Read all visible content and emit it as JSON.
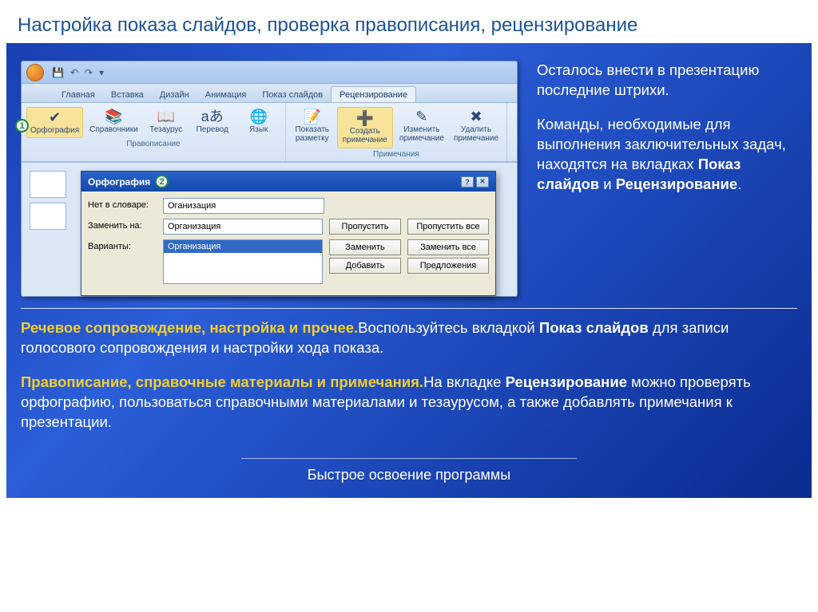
{
  "slide": {
    "title": "Настройка показа слайдов, проверка правописания, рецензирование",
    "footer": "Быстрое освоение программы"
  },
  "qat": [
    "💾",
    "↶",
    "↷",
    "▾"
  ],
  "tabs": [
    "Главная",
    "Вставка",
    "Дизайн",
    "Анимация",
    "Показ слайдов",
    "Рецензирование"
  ],
  "ribbon": {
    "group1": {
      "label": "Правописание",
      "items": [
        {
          "icon": "✔",
          "label": "Орфография",
          "sel": true,
          "name": "spelling-button"
        },
        {
          "icon": "📚",
          "label": "Справочники",
          "name": "research-button"
        },
        {
          "icon": "📖",
          "label": "Тезаурус",
          "name": "thesaurus-button"
        },
        {
          "icon": "aあ",
          "label": "Перевод",
          "name": "translate-button"
        },
        {
          "icon": "🌐",
          "label": "Язык",
          "name": "language-button"
        }
      ]
    },
    "group2": {
      "label": "Примечания",
      "items": [
        {
          "icon": "📝",
          "label": "Показать\nразметку",
          "name": "show-markup-button"
        },
        {
          "icon": "➕",
          "label": "Создать\nпримечание",
          "name": "new-comment-button",
          "sel": true,
          "big": true
        },
        {
          "icon": "✎",
          "label": "Изменить\nпримечание",
          "name": "edit-comment-button"
        },
        {
          "icon": "✖",
          "label": "Удалить\nпримечание",
          "name": "delete-comment-button"
        }
      ]
    }
  },
  "dialog": {
    "title": "Орфография",
    "labels": {
      "not_in_dict": "Нет в словаре:",
      "change_to": "Заменить на:",
      "variants": "Варианты:"
    },
    "not_in_dict": "Оганизация",
    "change_to": "Организация",
    "variant_sel": "Организация",
    "buttons": {
      "ignore": "Пропустить",
      "ignore_all": "Пропустить все",
      "change": "Заменить",
      "change_all": "Заменить все",
      "add": "Добавить",
      "suggest": "Предложения"
    }
  },
  "badges": {
    "one": "1",
    "two": "2"
  },
  "intro": {
    "p1": "Осталось внести в презентацию последние штрихи.",
    "p2a": "Команды, необходимые для выполнения заключительных задач, находятся на вкладках ",
    "p2b": "Показ слайдов",
    "p2c": " и ",
    "p2d": "Рецензирование",
    "p2e": "."
  },
  "body": {
    "p1a": "Речевое сопровождение, настройка и прочее.",
    "p1b": "Воспользуйтесь вкладкой ",
    "p1c": "Показ слайдов",
    "p1d": " для записи голосового сопровождения и настройки хода показа.",
    "p2a": "Правописание, справочные материалы и примечания.",
    "p2b": "На вкладке ",
    "p2c": "Рецензирование",
    "p2d": " можно проверять орфографию, пользоваться справочными материалами и тезаурусом, а также добавлять примечания к презентации."
  }
}
